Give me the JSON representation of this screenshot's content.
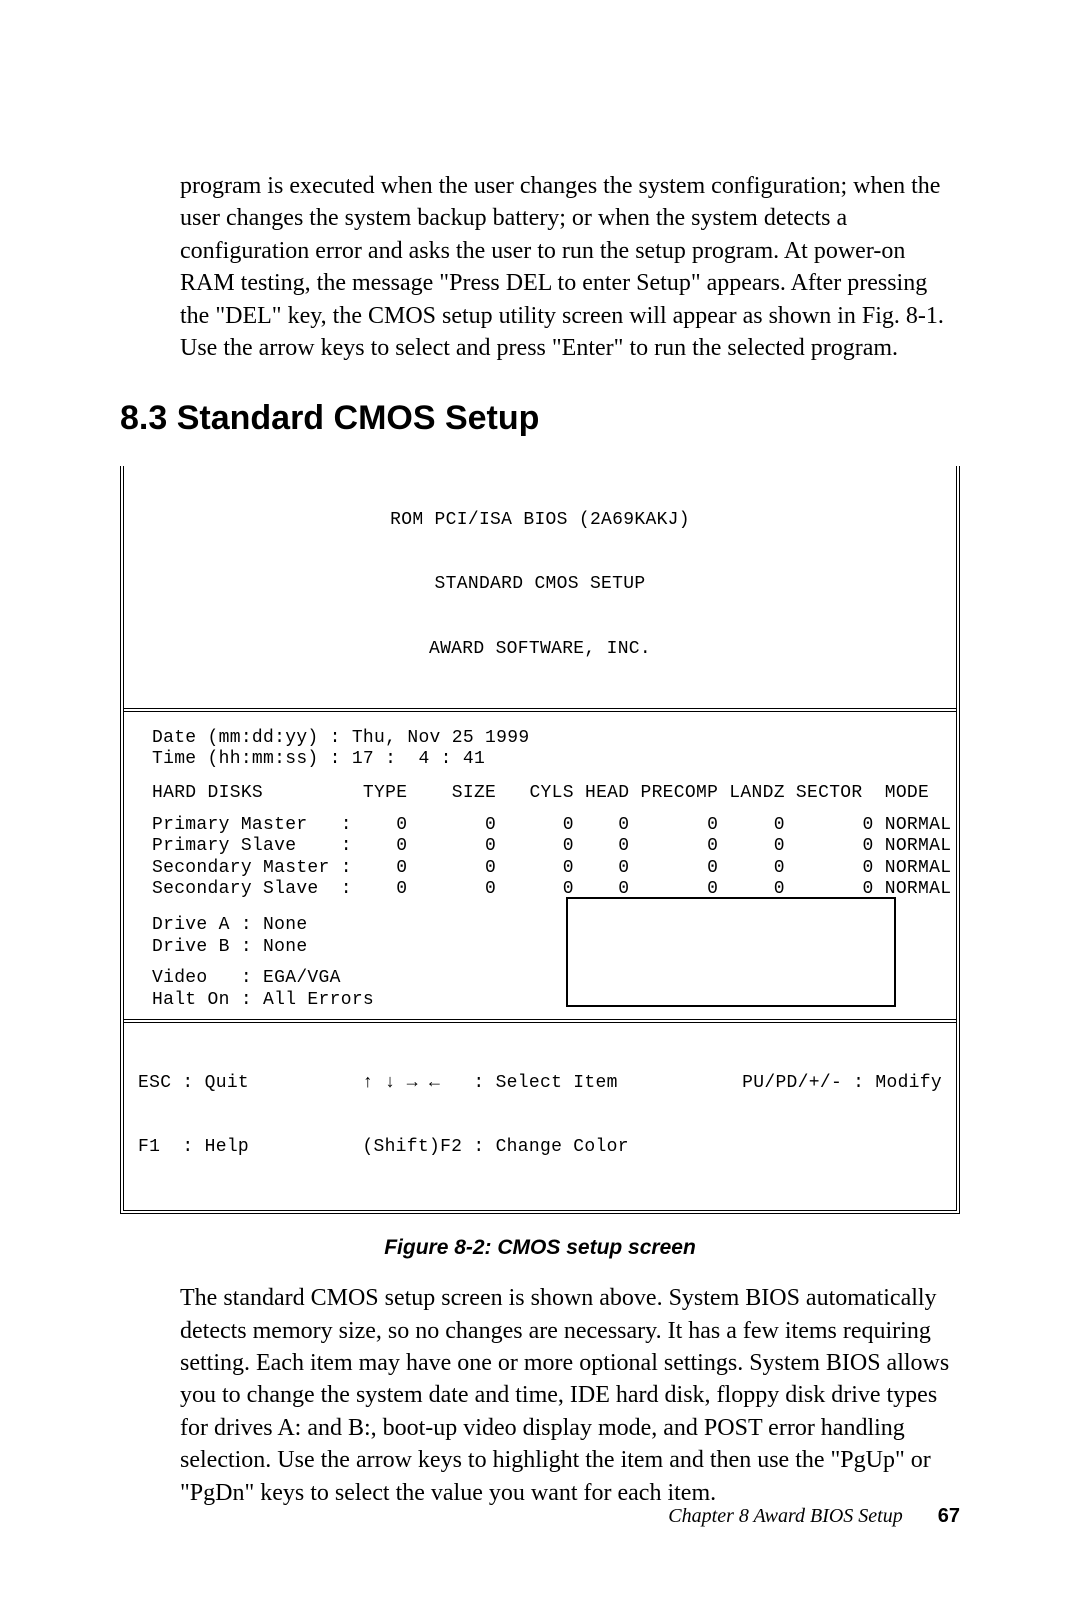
{
  "intro_paragraph": "program is executed when the user changes the system configuration; when the user changes the system backup battery; or when the system detects a configuration error and asks the user to run the setup program. At power-on RAM testing, the message \"Press DEL to enter Setup\" appears. After pressing the \"DEL\" key, the CMOS setup utility screen will appear as shown in Fig. 8-1. Use the arrow keys to select and press \"Enter\" to run the selected program.",
  "section_heading": "8.3 Standard CMOS Setup",
  "bios": {
    "header": {
      "line1": "ROM PCI/ISA BIOS (2A69KAKJ)",
      "line2": "STANDARD CMOS SETUP",
      "line3": "AWARD SOFTWARE, INC."
    },
    "date_line": "Date (mm:dd:yy) : Thu, Nov 25 1999",
    "time_line": "Time (hh:mm:ss) : 17 :  4 : 41",
    "disk_header": "HARD DISKS         TYPE    SIZE   CYLS HEAD PRECOMP LANDZ SECTOR  MODE",
    "disks": [
      "Primary Master   :    0       0      0    0       0     0       0 NORMAL",
      "Primary Slave    :    0       0      0    0       0     0       0 NORMAL",
      "Secondary Master :    0       0      0    0       0     0       0 NORMAL",
      "Secondary Slave  :    0       0      0    0       0     0       0 NORMAL"
    ],
    "drive_a": "Drive A : None",
    "drive_b": "Drive B : None",
    "video": "Video   : EGA/VGA",
    "halt_on": "Halt On : All Errors",
    "footer": {
      "left1": "ESC : Quit",
      "left2": "F1  : Help",
      "mid1": "↑ ↓ → ←   : Select Item",
      "mid2": "(Shift)F2 : Change Color",
      "right1": "PU/PD/+/- : Modify"
    }
  },
  "figure_caption": "Figure 8-2: CMOS setup screen",
  "body_paragraph": "The standard CMOS setup screen is shown above. System BIOS automatically detects memory size, so no changes are necessary. It has a few items requiring setting. Each item may have one or more optional settings. System BIOS allows you to change the system date and time, IDE hard disk, floppy disk drive types for drives A: and B:, boot-up video display mode, and POST error handling selection. Use the arrow keys to highlight the item and then use the \"PgUp\" or \"PgDn\" keys to select the value you want for each item.",
  "footer": {
    "chapter": "Chapter 8  Award BIOS Setup",
    "page": "67"
  }
}
